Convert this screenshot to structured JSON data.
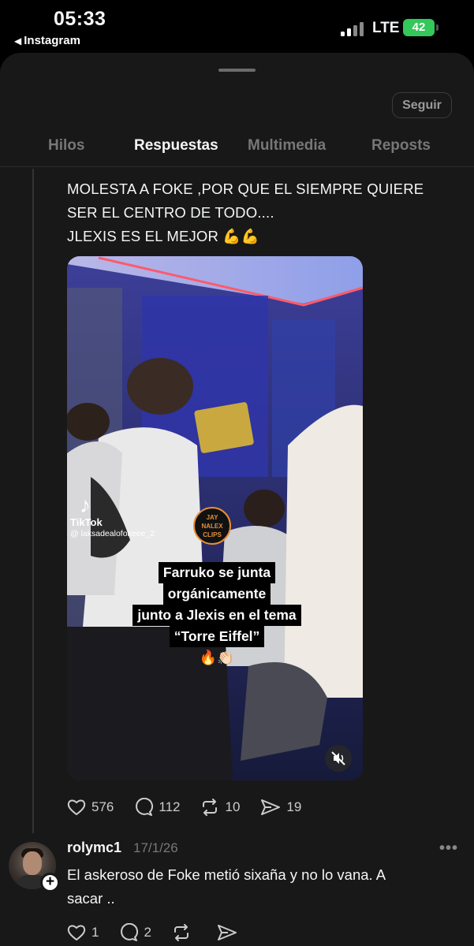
{
  "status_bar": {
    "time": "05:33",
    "back_app": "Instagram",
    "network": "LTE",
    "battery": "42"
  },
  "header": {
    "follow_label": "Seguir"
  },
  "tabs": [
    {
      "label": "Hilos"
    },
    {
      "label": "Respuestas"
    },
    {
      "label": "Multimedia"
    },
    {
      "label": "Reposts"
    }
  ],
  "post": {
    "text_lines": [
      "MOLESTA A FOKE ,POR QUE EL SIEMPRE QUIERE",
      "SER EL CENTRO DE TODO....",
      "JLEXIS ES EL MEJOR 💪💪"
    ],
    "media": {
      "tiktok_label": "TikTok",
      "tiktok_user": "@ laksadealofokeee_2",
      "sticker_text": "JAY NALEX CLIPS",
      "caption_lines": [
        "Farruko se junta",
        "orgánicamente",
        "junto a Jlexis en el tema",
        "“Torre Eiffel”"
      ],
      "caption_emojis": "🔥👏🏻"
    },
    "counts": {
      "likes": "576",
      "replies": "112",
      "reposts": "10",
      "shares": "19"
    }
  },
  "reply": {
    "username": "rolymc1",
    "date": "17/1/26",
    "text_lines": [
      "El askeroso de Foke metió sixaña y no lo vana. A",
      "sacar .."
    ],
    "counts": {
      "likes": "1",
      "replies": "2"
    }
  },
  "colors": {
    "background": "#181818",
    "text": "#f3f5f7",
    "muted": "#777777",
    "battery": "#34c759"
  }
}
